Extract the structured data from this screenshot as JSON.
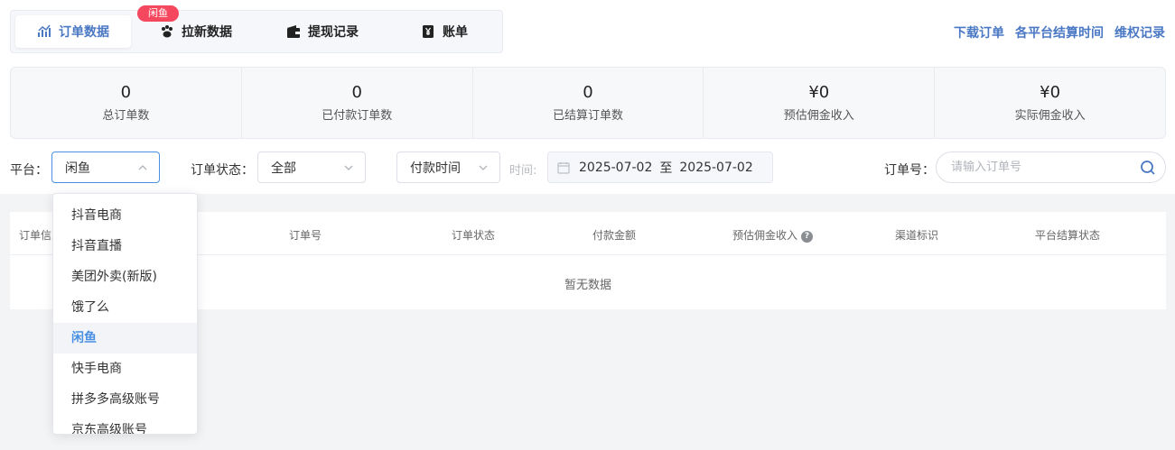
{
  "tabs": [
    {
      "label": "订单数据",
      "icon": "chart-line-icon",
      "active": true
    },
    {
      "label": "拉新数据",
      "icon": "paw-icon"
    },
    {
      "label": "提现记录",
      "icon": "wallet-icon"
    },
    {
      "label": "账单",
      "icon": "yen-bill-icon"
    }
  ],
  "badge": "闲鱼",
  "toplinks": [
    "下载订单",
    "各平台结算时间",
    "维权记录"
  ],
  "stats": [
    {
      "value": "0",
      "label": "总订单数"
    },
    {
      "value": "0",
      "label": "已付款订单数"
    },
    {
      "value": "0",
      "label": "已结算订单数"
    },
    {
      "value": "¥0",
      "label": "预估佣金收入"
    },
    {
      "value": "¥0",
      "label": "实际佣金收入"
    }
  ],
  "filters": {
    "platform_label": "平台：",
    "platform_value": "闲鱼",
    "status_label": "订单状态：",
    "status_value": "全部",
    "time_type": "付款时间",
    "time_label": "时间:",
    "date_start": "2025-07-02",
    "date_to": "至",
    "date_end": "2025-07-02",
    "order_no_label": "订单号：",
    "order_no_placeholder": "请输入订单号"
  },
  "table": {
    "columns": [
      "订单信息",
      "订单号",
      "订单状态",
      "付款金额",
      "预估佣金收入",
      "渠道标识",
      "平台结算状态"
    ],
    "empty_text": "暂无数据"
  },
  "dropdown": {
    "options": [
      "抖音电商",
      "抖音直播",
      "美团外卖(新版)",
      "饿了么",
      "闲鱼",
      "快手电商",
      "拼多多高级账号",
      "京东高级账号"
    ],
    "selected": "闲鱼"
  },
  "colors": {
    "accent": "#4a78c4",
    "badge": "#f5475d"
  }
}
